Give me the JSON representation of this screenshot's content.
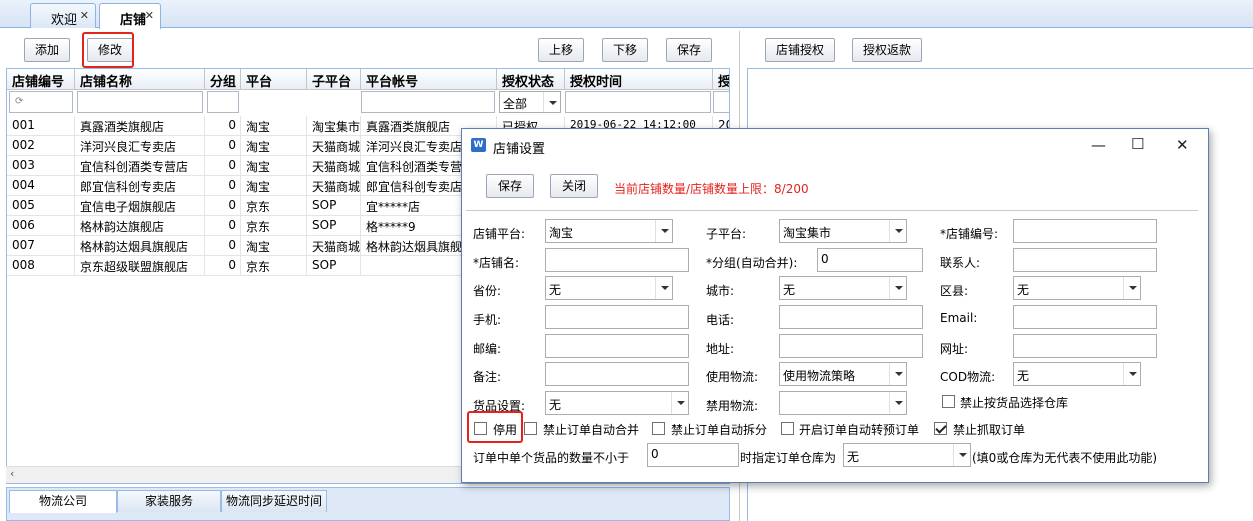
{
  "tabs": [
    {
      "label": "欢迎"
    },
    {
      "label": "店铺"
    }
  ],
  "toolbar": {
    "add": "添加",
    "edit": "修改",
    "up": "上移",
    "down": "下移",
    "save": "保存",
    "auth": "店铺授权",
    "auth_rebate": "授权返款"
  },
  "grid": {
    "columns": [
      "店铺编号",
      "店铺名称",
      "分组",
      "平台",
      "子平台",
      "平台帐号",
      "授权状态",
      "授权时间",
      "授"
    ],
    "filter_status": "全部",
    "rows": [
      {
        "id": "001",
        "name": "真露酒类旗舰店",
        "group": "0",
        "platform": "淘宝",
        "sub": "淘宝集市",
        "account": "真露酒类旗舰店",
        "status": "已授权",
        "time": "2019-06-22 14:12:00",
        "more": "20"
      },
      {
        "id": "002",
        "name": "洋河兴良汇专卖店",
        "group": "0",
        "platform": "淘宝",
        "sub": "天猫商城",
        "account": "洋河兴良汇专卖店",
        "status": "",
        "time": "",
        "more": ""
      },
      {
        "id": "003",
        "name": "宜信科创酒类专营店",
        "group": "0",
        "platform": "淘宝",
        "sub": "天猫商城",
        "account": "宜信科创酒类专营",
        "status": "",
        "time": "",
        "more": ""
      },
      {
        "id": "004",
        "name": "郎宜信科创专卖店",
        "group": "0",
        "platform": "淘宝",
        "sub": "天猫商城",
        "account": "郎宜信科创专卖店",
        "status": "",
        "time": "",
        "more": ""
      },
      {
        "id": "005",
        "name": "宜信电子烟旗舰店",
        "group": "0",
        "platform": "京东",
        "sub": "SOP",
        "account": "宜*****店",
        "status": "",
        "time": "",
        "more": ""
      },
      {
        "id": "006",
        "name": "格林韵达旗舰店",
        "group": "0",
        "platform": "京东",
        "sub": "SOP",
        "account": "格*****9",
        "status": "",
        "time": "",
        "more": ""
      },
      {
        "id": "007",
        "name": "格林韵达烟具旗舰店",
        "group": "0",
        "platform": "淘宝",
        "sub": "天猫商城",
        "account": "格林韵达烟具旗舰",
        "status": "",
        "time": "",
        "more": ""
      },
      {
        "id": "008",
        "name": "京东超级联盟旗舰店",
        "group": "0",
        "platform": "京东",
        "sub": "SOP",
        "account": "",
        "status": "",
        "time": "",
        "more": ""
      }
    ]
  },
  "bottom_tabs": [
    "物流公司",
    "家装服务",
    "物流同步延迟时间"
  ],
  "dialog": {
    "title": "店铺设置",
    "save": "保存",
    "close": "关闭",
    "count_info": "当前店铺数量/店铺数量上限：8/200",
    "labels": {
      "platform": "店铺平台:",
      "sub_platform": "子平台:",
      "shop_no": "*店铺编号:",
      "shop_name": "*店铺名:",
      "group": "*分组(自动合并):",
      "contact": "联系人:",
      "province": "省份:",
      "city": "城市:",
      "district": "区县:",
      "mobile": "手机:",
      "phone": "电话:",
      "email": "Email:",
      "zip": "邮编:",
      "address": "地址:",
      "website": "网址:",
      "remark": "备注:",
      "use_logistics": "使用物流:",
      "cod_logistics": "COD物流:",
      "goods_setting": "货品设置:",
      "ban_logistics": "禁用物流:"
    },
    "values": {
      "platform": "淘宝",
      "sub_platform": "淘宝集市",
      "group": "0",
      "province": "无",
      "city": "无",
      "district": "无",
      "use_logistics": "使用物流策略",
      "cod_logistics": "无",
      "goods_setting": "无",
      "warehouse_qty": "0",
      "warehouse": "无"
    },
    "checks": {
      "ban_warehouse_by_goods": "禁止按货品选择仓库",
      "disable": "停用",
      "ban_auto_merge": "禁止订单自动合并",
      "ban_auto_split": "禁止订单自动拆分",
      "auto_preorder": "开启订单自动转预订单",
      "ban_fetch": "禁止抓取订单"
    },
    "warehouse_rule": {
      "prefix": "订单中单个货品的数量不小于",
      "mid": "时指定订单仓库为",
      "suffix": "(填0或仓库为无代表不使用此功能)"
    },
    "check_states": {
      "ban_warehouse_by_goods": false,
      "disable": false,
      "ban_auto_merge": false,
      "ban_auto_split": false,
      "auto_preorder": false,
      "ban_fetch": true
    }
  }
}
